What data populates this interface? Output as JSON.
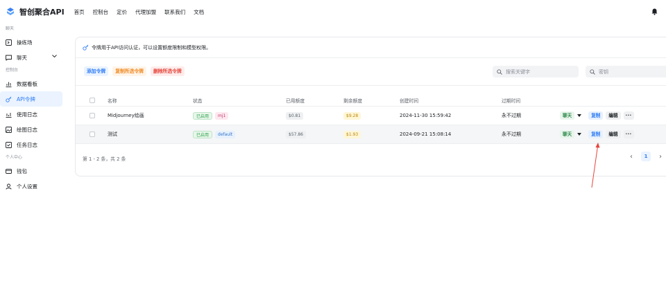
{
  "brand": {
    "name": "智创聚合API"
  },
  "nav": [
    "首页",
    "控制台",
    "定价",
    "代理加盟",
    "联系我们",
    "文档"
  ],
  "sidebar": {
    "groups": [
      {
        "label": "聊天",
        "items": [
          {
            "label": "操练场",
            "icon": "playground-icon"
          },
          {
            "label": "聊天",
            "icon": "chat-icon"
          }
        ]
      },
      {
        "label": "控制台",
        "items": [
          {
            "label": "数据看板",
            "icon": "chart-icon"
          },
          {
            "label": "API令牌",
            "icon": "key-icon"
          },
          {
            "label": "使用日志",
            "icon": "log-icon"
          },
          {
            "label": "绘图日志",
            "icon": "image-icon"
          },
          {
            "label": "任务日志",
            "icon": "task-icon"
          }
        ]
      },
      {
        "label": "个人中心",
        "items": [
          {
            "label": "钱包",
            "icon": "wallet-icon"
          },
          {
            "label": "个人设置",
            "icon": "user-icon"
          }
        ]
      }
    ]
  },
  "card": {
    "info": "令牌用于API访问认证，可以设置额度限制和模型权限。",
    "buttons": {
      "add": "添加令牌",
      "copy_selected": "复制所选令牌",
      "delete_selected": "删除所选令牌"
    },
    "search_keyword": {
      "placeholder": "搜索关键字"
    },
    "search_key": {
      "placeholder": "密钥"
    }
  },
  "table": {
    "headers": {
      "name": "名称",
      "status": "状态",
      "used": "已用额度",
      "remain": "剩余额度",
      "created": "创建时间",
      "expire": "过期时间"
    },
    "rows": [
      {
        "name": "Midjourney绘画",
        "status": "已启用",
        "group": "mj1",
        "used": "$0.81",
        "remain": "$9.28",
        "created": "2024-11-30 15:59:42",
        "expire": "永不过期"
      },
      {
        "name": "测试",
        "status": "已启用",
        "group": "default",
        "used": "$57.86",
        "remain": "$1.93",
        "created": "2024-09-21 15:08:14",
        "expire": "永不过期"
      }
    ],
    "actions": {
      "chat": "聊天",
      "copy": "复制",
      "edit": "编辑",
      "more": "···"
    }
  },
  "pagination": {
    "summary": "第 1 - 2 条，共 2 条",
    "current": "1",
    "prev": "‹",
    "next": "›"
  },
  "colors": {
    "primary": "#2f7cf6",
    "annotation_arrow": "#e5453b"
  }
}
